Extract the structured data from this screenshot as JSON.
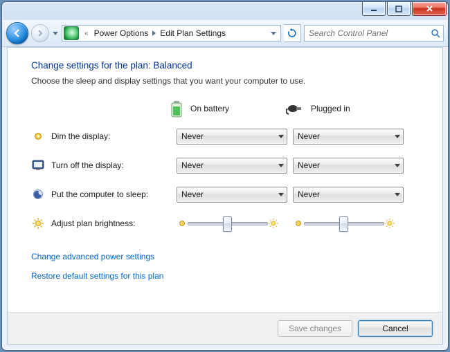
{
  "titlebar": {
    "minimize": "–",
    "maximize": "▢",
    "close": "✕"
  },
  "breadcrumb": {
    "level1": "Power Options",
    "level2": "Edit Plan Settings"
  },
  "search": {
    "placeholder": "Search Control Panel"
  },
  "heading": "Change settings for the plan: Balanced",
  "subheading": "Choose the sleep and display settings that you want your computer to use.",
  "columns": {
    "battery": "On battery",
    "plugged": "Plugged in"
  },
  "rows": {
    "dim": {
      "label": "Dim the display:",
      "battery": "Never",
      "plugged": "Never"
    },
    "off": {
      "label": "Turn off the display:",
      "battery": "Never",
      "plugged": "Never"
    },
    "sleep": {
      "label": "Put the computer to sleep:",
      "battery": "Never",
      "plugged": "Never"
    },
    "bright": {
      "label": "Adjust plan brightness:"
    }
  },
  "sliders": {
    "battery": {
      "position_pct": 48
    },
    "plugged": {
      "position_pct": 48
    }
  },
  "links": {
    "advanced": "Change advanced power settings",
    "restore": "Restore default settings for this plan"
  },
  "buttons": {
    "save": "Save changes",
    "cancel": "Cancel"
  }
}
